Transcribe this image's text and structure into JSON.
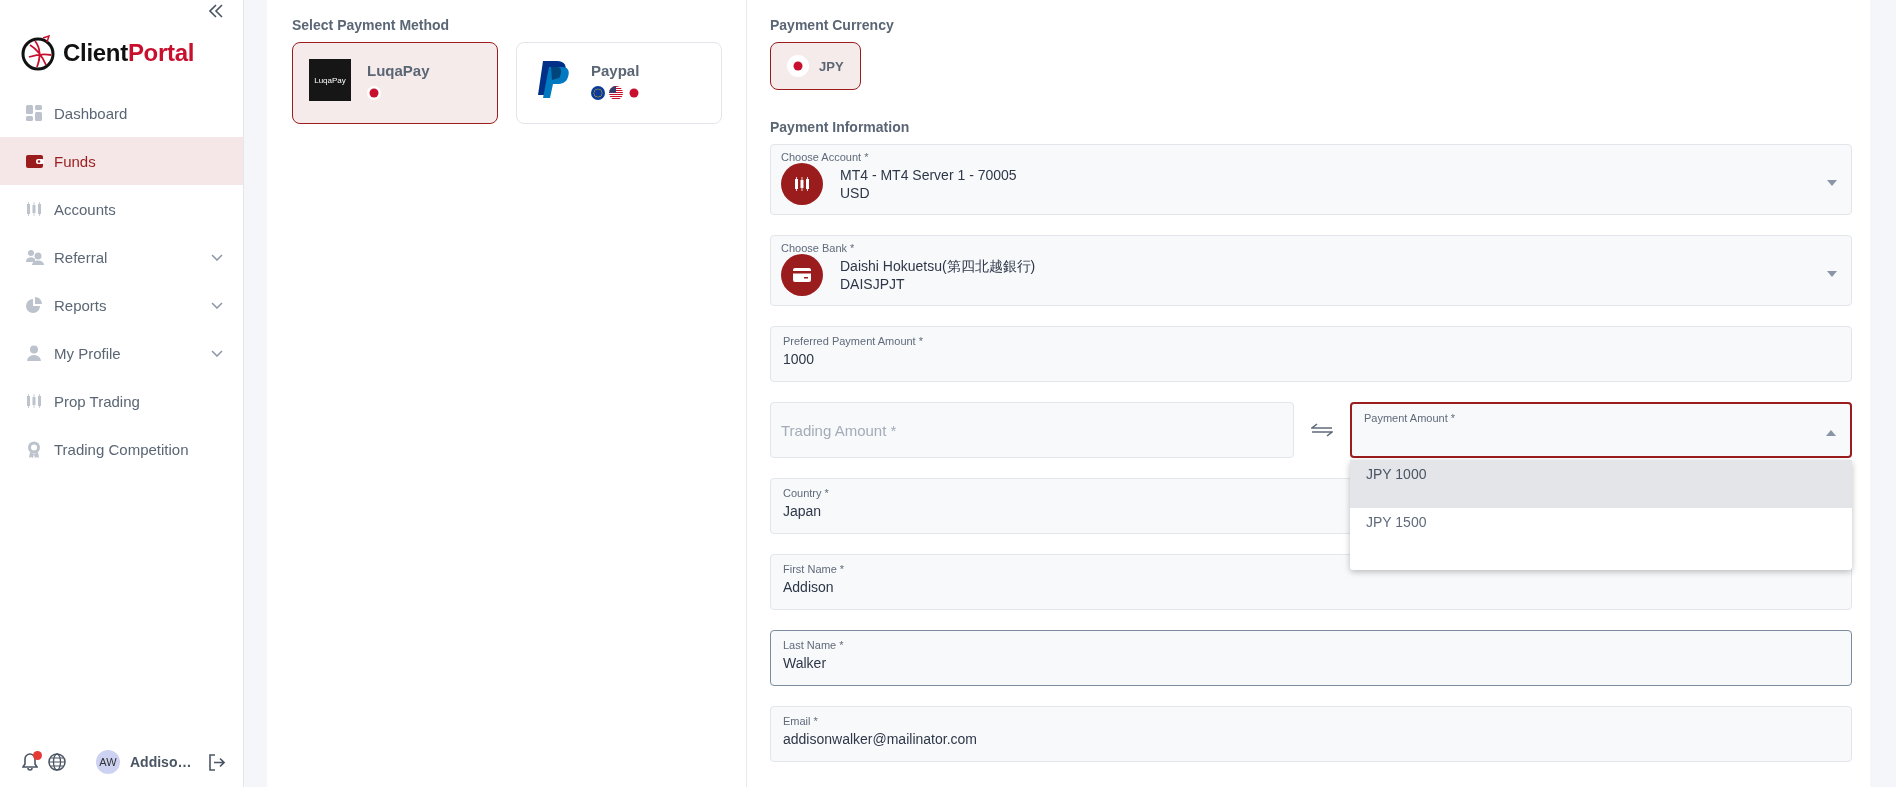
{
  "sidebar": {
    "brand": {
      "part_1": "Client",
      "part_2": "Portal"
    },
    "items": [
      {
        "label": "Dashboard",
        "selected": false,
        "expandable": false
      },
      {
        "label": "Funds",
        "selected": true,
        "expandable": false
      },
      {
        "label": "Accounts",
        "selected": false,
        "expandable": false
      },
      {
        "label": "Referral",
        "selected": false,
        "expandable": true
      },
      {
        "label": "Reports",
        "selected": false,
        "expandable": true
      },
      {
        "label": "My Profile",
        "selected": false,
        "expandable": true
      },
      {
        "label": "Prop Trading",
        "selected": false,
        "expandable": false
      },
      {
        "label": "Trading Competition",
        "selected": false,
        "expandable": false
      }
    ],
    "user": {
      "initials": "AW",
      "name": "Addiso…",
      "has_notifications": true
    }
  },
  "payment_methods": {
    "title": "Select Payment Method",
    "options": [
      {
        "name": "LuqaPay",
        "logo_text": "LuqaPay",
        "selected": true
      },
      {
        "name": "Paypal",
        "selected": false
      }
    ]
  },
  "payment_currency": {
    "title": "Payment Currency",
    "options": [
      {
        "code": "JPY",
        "selected": true
      }
    ]
  },
  "payment_information": {
    "title": "Payment Information",
    "fields": [
      {
        "kind": "icon_select",
        "label": "Choose Account *",
        "value": "MT4 - MT4 Server 1 - 70005",
        "subvalue": "USD"
      },
      {
        "kind": "icon_select",
        "label": "Choose Bank *",
        "value": "Daishi Hokuetsu(第四北越銀行)",
        "subvalue": "DAISJPJT"
      },
      {
        "kind": "text",
        "label": "Preferred Payment Amount *",
        "value": "1000",
        "focused": false
      },
      {
        "kind": "exchange",
        "left": {
          "placeholder": "Trading Amount *"
        },
        "right": {
          "label": "Payment Amount *",
          "open": true,
          "options": [
            {
              "label": "JPY 1000",
              "selected": true
            },
            {
              "label": "JPY 1500",
              "selected": false
            }
          ]
        }
      },
      {
        "kind": "text",
        "label": "Country *",
        "value": "Japan",
        "focused": false
      },
      {
        "kind": "text",
        "label": "First Name *",
        "value": "Addison",
        "focused": false
      },
      {
        "kind": "text",
        "label": "Last Name *",
        "value": "Walker",
        "focused": true
      },
      {
        "kind": "text",
        "label": "Email *",
        "value": "addisonwalker@mailinator.com",
        "focused": false
      }
    ]
  }
}
